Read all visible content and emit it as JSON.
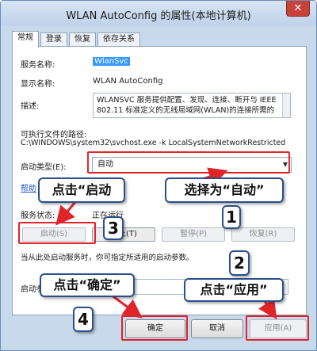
{
  "window": {
    "title": "WLAN AutoConfig 的属性(本地计算机)",
    "close_glyph": "✕"
  },
  "tabs": [
    {
      "label": "常规"
    },
    {
      "label": "登录"
    },
    {
      "label": "恢复"
    },
    {
      "label": "依存关系"
    }
  ],
  "general": {
    "service_name_label": "服务名称:",
    "service_name_value": "WlanSvc",
    "display_name_label": "显示名称:",
    "display_name_value": "WLAN AutoConfig",
    "description_label": "描述:",
    "description_line1": "WLANSVC 服务提供配置、发现、连接、断开与 IEEE",
    "description_line2": "802.11 标准定义的无线局域网(WLAN)的连接所需的",
    "exe_path_label": "可执行文件的路径:",
    "exe_path_value": "C:\\WINDOWS\\system32\\svchost.exe -k LocalSystemNetworkRestricted",
    "startup_type_label": "启动类型(E):",
    "startup_type_value": "自动",
    "help_link": "帮助",
    "service_status_label": "服务状态:",
    "service_status_value": "正在运行",
    "start_button": "启动(S)",
    "stop_button": "停止(T)",
    "pause_button": "暂停(P)",
    "resume_button": "恢复(R)",
    "hint_text": "当从此处启动服务时，你可指定所适用的启动参数。",
    "start_params_label": "启动参数(M):"
  },
  "dialog_buttons": {
    "ok": "确定",
    "cancel": "取消",
    "apply": "应用(A)"
  },
  "annotations": {
    "click_start": "点击“启动",
    "select_auto": "选择为“自动”",
    "click_ok": "点击“确定”",
    "click_apply": "点击“应用”",
    "n1": "1",
    "n2": "2",
    "n3": "3",
    "n4": "4"
  },
  "colors": {
    "highlight_red": "#e0242a",
    "callout_border": "#2a4f8a",
    "selection_blue": "#3399ff"
  }
}
